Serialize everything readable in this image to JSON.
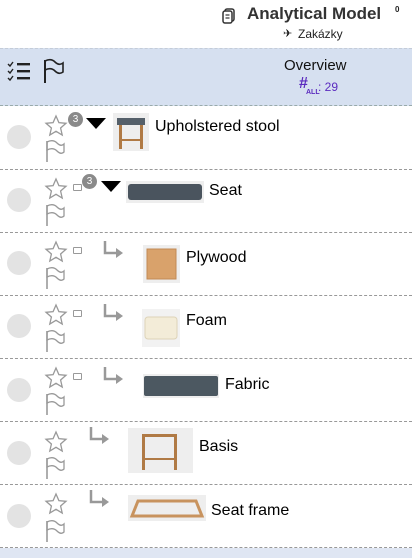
{
  "header": {
    "title": "Analytical Model",
    "badge": "0",
    "subtitle": "Zakázky",
    "icons": [
      "model-icon",
      "pin-icon"
    ]
  },
  "toolbar": {
    "overview_title": "Overview",
    "hash_symbol": "#",
    "hash_scope": "ALL",
    "count_text": ": 29",
    "accent_color": "#5b2bbf",
    "background_color": "#d6e0f0"
  },
  "items": [
    {
      "name": "Upholstered stool",
      "badge": "3",
      "expandable": true,
      "child_arrow": false
    },
    {
      "name": "Seat",
      "badge": "3",
      "expandable": true,
      "child_arrow": false
    },
    {
      "name": "Plywood",
      "badge": "",
      "expandable": false,
      "child_arrow": true
    },
    {
      "name": "Foam",
      "badge": "",
      "expandable": false,
      "child_arrow": true
    },
    {
      "name": "Fabric",
      "badge": "",
      "expandable": false,
      "child_arrow": true
    },
    {
      "name": "Basis",
      "badge": "",
      "expandable": false,
      "child_arrow": true
    },
    {
      "name": "Seat frame",
      "badge": "",
      "expandable": false,
      "child_arrow": true
    }
  ]
}
